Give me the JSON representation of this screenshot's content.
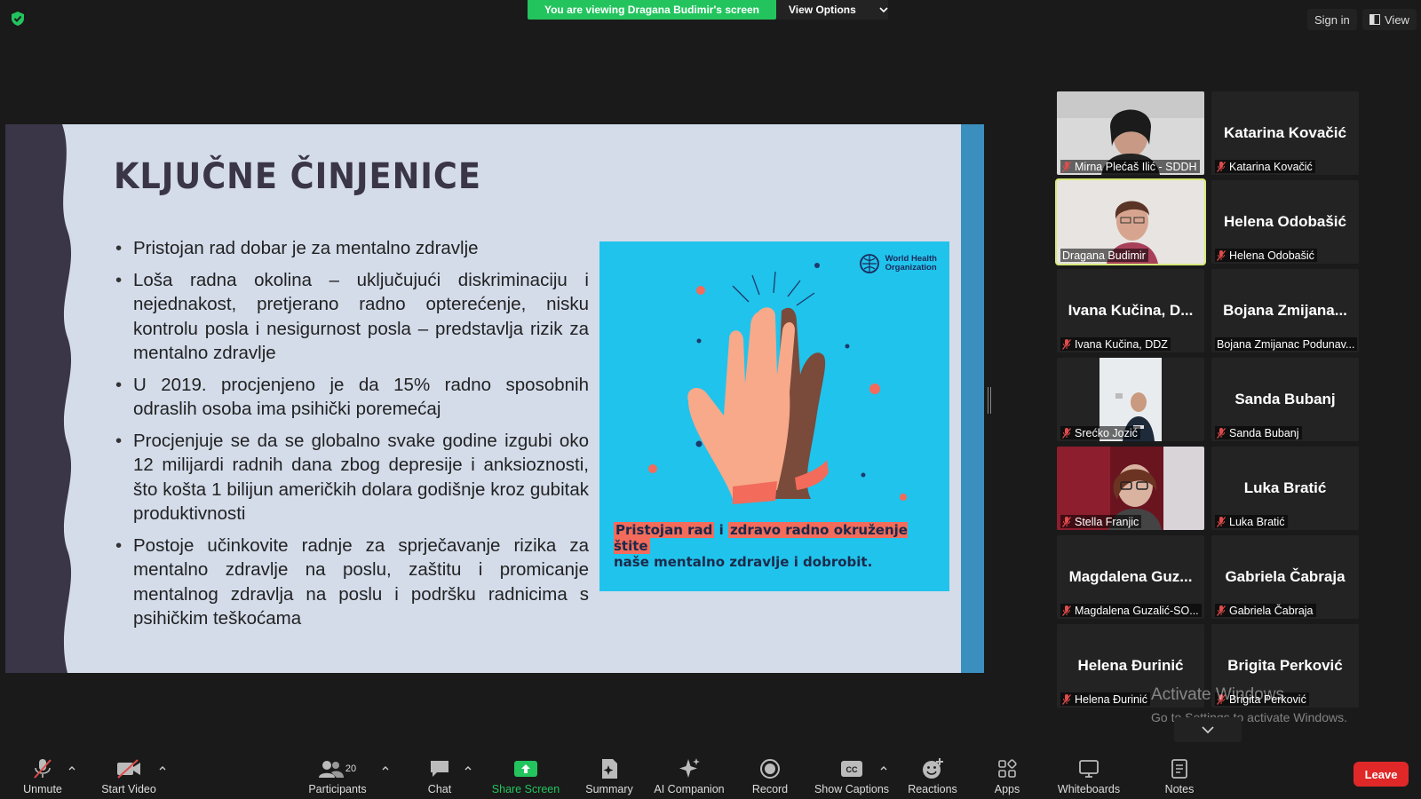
{
  "top": {
    "banner": "You are viewing Dragana Budimir's screen",
    "view_options": "View Options",
    "sign_in": "Sign in",
    "view": "View"
  },
  "slide": {
    "title": "KLJUČNE ČINJENICE",
    "bullets": [
      "Pristojan rad dobar je za mentalno zdravlje",
      "Loša radna okolina – uključujući diskriminaciju i nejednakost, pretjerano radno opterećenje, nisku kontrolu posla i nesigurnost posla – predstavlja rizik za mentalno zdravlje",
      "U 2019. procjenjeno je da 15% radno sposobnih odraslih osoba ima psihički poremećaj",
      "Procjenjuje se da se globalno svake godine izgubi oko 12 milijardi radnih dana zbog depresije i anksioznosti, što košta 1 bilijun američkih dolara godišnje kroz gubitak produktivnosti",
      "Postoje učinkovite radnje za sprječavanje rizika za mentalno zdravlje na poslu, zaštitu i promicanje mentalnog zdravlja na poslu i podršku radnicima s psihičkim teškoćama"
    ],
    "who_logo_line1": "World Health",
    "who_logo_line2": "Organization",
    "caption_hl1": "Pristojan rad",
    "caption_mid": " i ",
    "caption_hl2": "zdravo radno okruženje štite",
    "caption_rest": "naše mentalno zdravlje i dobrobit."
  },
  "participants": [
    {
      "big": "",
      "tag": "Mirna Plećaš Ilić - SDDH",
      "video": true
    },
    {
      "big": "Katarina Kovačić",
      "tag": "Katarina Kovačić",
      "video": false
    },
    {
      "big": "",
      "tag": "Dragana Budimir",
      "video": true
    },
    {
      "big": "Helena Odobašić",
      "tag": "Helena Odobašić",
      "video": false
    },
    {
      "big": "Ivana Kučina, D...",
      "tag": "Ivana Kučina, DDZ",
      "video": false
    },
    {
      "big": "Bojana Zmijana...",
      "tag": "Bojana Zmijanac Podunav...",
      "video": false
    },
    {
      "big": "",
      "tag": "Srećko Jozić",
      "video": true
    },
    {
      "big": "Sanda Bubanj",
      "tag": "Sanda Bubanj",
      "video": false
    },
    {
      "big": "",
      "tag": "Stella Franjic",
      "video": true
    },
    {
      "big": "Luka Bratić",
      "tag": "Luka Bratić",
      "video": false
    },
    {
      "big": "Magdalena Guz...",
      "tag": "Magdalena Guzalić-SO...",
      "video": false
    },
    {
      "big": "Gabriela Čabraja",
      "tag": "Gabriela Čabraja",
      "video": false
    },
    {
      "big": "Helena Đurinić",
      "tag": "Helena Đurinić",
      "video": false
    },
    {
      "big": "Brigita Perković",
      "tag": "Brigita Perković",
      "video": false
    }
  ],
  "watermark": {
    "line1": "Activate Windows",
    "line2": "Go to Settings to activate Windows."
  },
  "toolbar": {
    "unmute": "Unmute",
    "start_video": "Start Video",
    "participants": "Participants",
    "participants_count": "20",
    "chat": "Chat",
    "share_screen": "Share Screen",
    "summary": "Summary",
    "ai_companion": "AI Companion",
    "record": "Record",
    "show_captions": "Show Captions",
    "captions_icon_text": "CC",
    "reactions": "Reactions",
    "apps": "Apps",
    "whiteboards": "Whiteboards",
    "notes": "Notes",
    "leave": "Leave"
  },
  "colors": {
    "banner_green": "#23c45e",
    "leave_red": "#e02828",
    "active_speaker": "#d7e87a",
    "slide_bg": "#d4dcea",
    "who_card": "#20c3ec",
    "caption_highlight": "#f26b5b"
  }
}
